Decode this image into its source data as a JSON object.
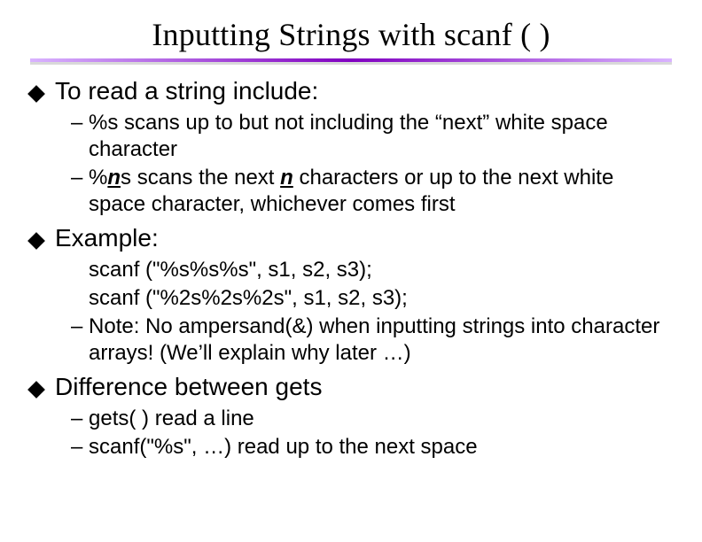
{
  "title": "Inputting Strings with scanf ( )",
  "points": {
    "p1": {
      "head": "To read a string include:",
      "s1_a": "– %s  scans up to but not including the “next” white space character",
      "s2_a": "– %",
      "s2_n1": "n",
      "s2_b": "s scans the next ",
      "s2_n2": "n",
      "s2_c": " characters or up to the next white space character, whichever comes first"
    },
    "p2": {
      "head": "Example:",
      "code1": "scanf (\"%s%s%s\", s1, s2, s3);",
      "code2": "scanf (\"%2s%2s%2s\", s1, s2, s3);",
      "note": "– Note:  No ampersand(&) when inputting strings into character arrays!  (We’ll explain why later …)"
    },
    "p3": {
      "head": "Difference between gets",
      "s1": "– gets( )  read a line",
      "s2": "– scanf(\"%s\", …) read up to the next space"
    }
  }
}
